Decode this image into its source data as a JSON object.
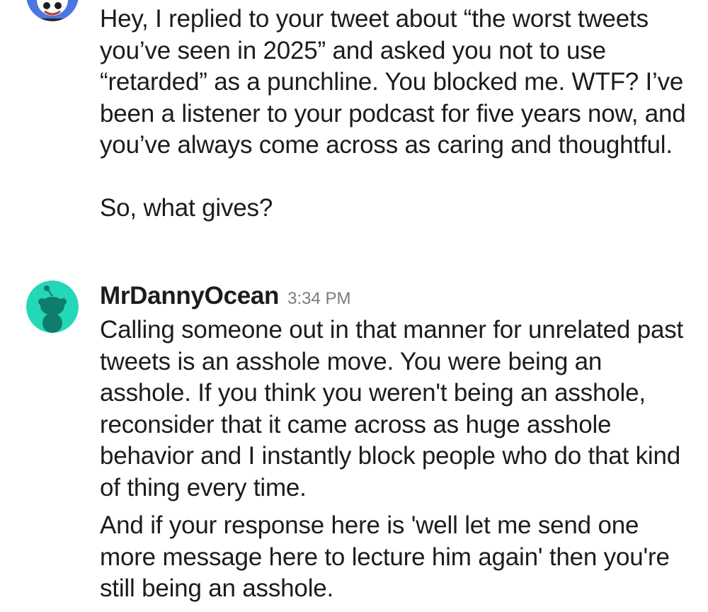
{
  "conversation": {
    "message1": {
      "paragraphs": [
        "Hey, I replied to your tweet about “the worst tweets you’ve seen in 2025” and asked you not to use “retarded” as a punchline. You blocked me. WTF? I’ve been a listener to your podcast for five years now, and you’ve always come across as caring and thoughtful.",
        "So, what gives?"
      ],
      "avatar_icon": "snoo-avatar-icon"
    },
    "message2": {
      "author": "MrDannyOcean",
      "timestamp": "3:34 PM",
      "avatar_icon": "snoo-avatar-icon",
      "avatar_color": "#24d7b6",
      "paragraphs": [
        "Calling someone out in that manner for unrelated past tweets is an asshole move. You were being an asshole. If you think you weren't being an asshole, reconsider that it came across as huge asshole behavior and I instantly block people who do that kind of thing every time.",
        "And if your response here is 'well let me send one more message here to lecture him again' then you're still being an asshole."
      ]
    }
  }
}
